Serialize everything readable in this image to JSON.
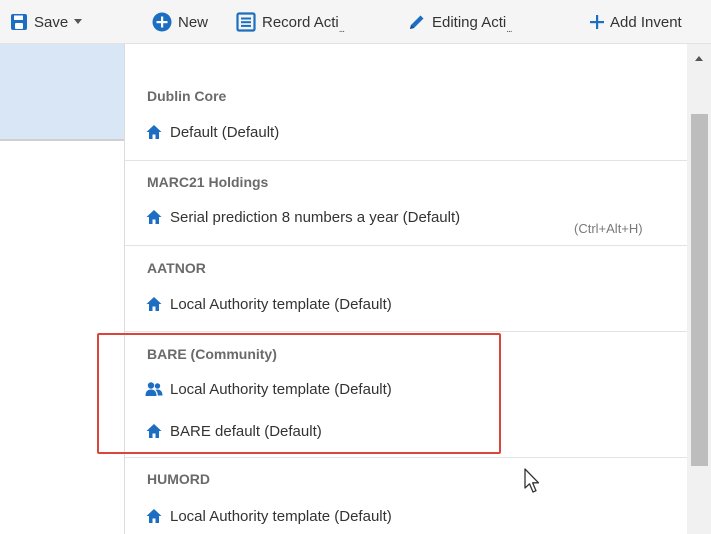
{
  "toolbar": {
    "save_label": "Save",
    "new_label": "New",
    "record_actions_label": "Record Acti",
    "editing_actions_label": "Editing Acti",
    "add_inventory_label": "Add Invent",
    "ellipsis": "..."
  },
  "menu": {
    "groups": [
      {
        "header": "Dublin Core",
        "items": [
          {
            "label": "Default (Default)",
            "icon": "home-icon"
          }
        ]
      },
      {
        "header": "MARC21 Holdings",
        "items": [
          {
            "label": "Serial prediction 8 numbers a year (Default)",
            "icon": "home-icon",
            "shortcut": "(Ctrl+Alt+H)"
          }
        ]
      },
      {
        "header": "AATNOR",
        "items": [
          {
            "label": "Local Authority template (Default)",
            "icon": "home-icon"
          }
        ]
      },
      {
        "header": "BARE (Community)",
        "items": [
          {
            "label": "Local Authority template (Default)",
            "icon": "community-icon"
          },
          {
            "label": "BARE default (Default)",
            "icon": "home-icon"
          }
        ]
      },
      {
        "header": "HUMORD",
        "items": [
          {
            "label": "Local Authority template (Default)",
            "icon": "home-icon"
          }
        ]
      }
    ]
  },
  "colors": {
    "accent_blue": "#1b6ec2",
    "highlight_red": "#d9463a",
    "selected_row_bg": "#d9e6f6"
  }
}
